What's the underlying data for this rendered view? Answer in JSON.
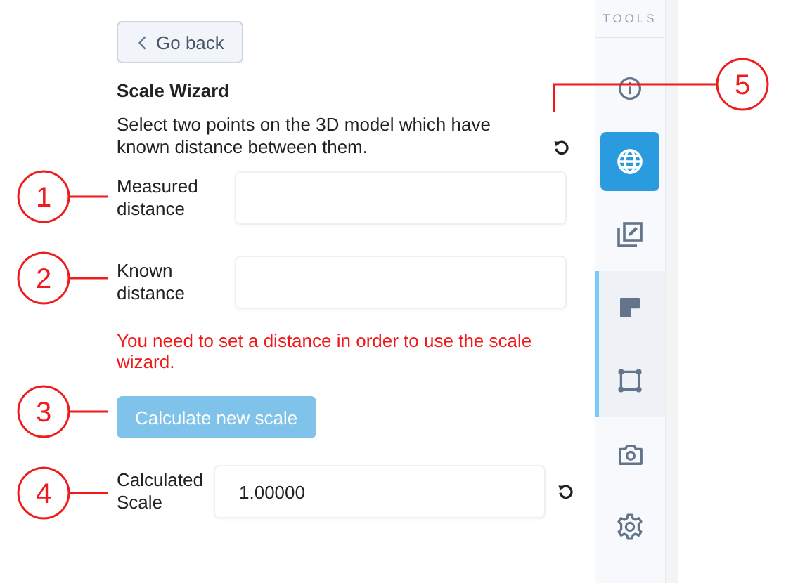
{
  "back_button": {
    "label": "Go back"
  },
  "wizard": {
    "title": "Scale Wizard",
    "description": "Select two points on the 3D model which have known distance between them.",
    "fields": [
      {
        "label": "Measured distance"
      },
      {
        "label": "Known distance"
      }
    ],
    "error": "You need to set a distance in order to use the scale wizard.",
    "calculate_button": {
      "label": "Calculate new scale",
      "disabled": true
    },
    "result": {
      "label": "Calculated Scale",
      "value": "1.00000"
    }
  },
  "sidebar": {
    "title": "TOOLS",
    "tools": [
      {
        "selected": false,
        "grouped": false
      },
      {
        "selected": true,
        "grouped": false
      },
      {
        "selected": false,
        "grouped": false
      },
      {
        "selected": false,
        "grouped": true
      },
      {
        "selected": false,
        "grouped": true
      },
      {
        "selected": false,
        "grouped": false
      },
      {
        "selected": false,
        "grouped": false
      }
    ]
  },
  "callouts": [
    "1",
    "2",
    "3",
    "4",
    "5"
  ]
}
